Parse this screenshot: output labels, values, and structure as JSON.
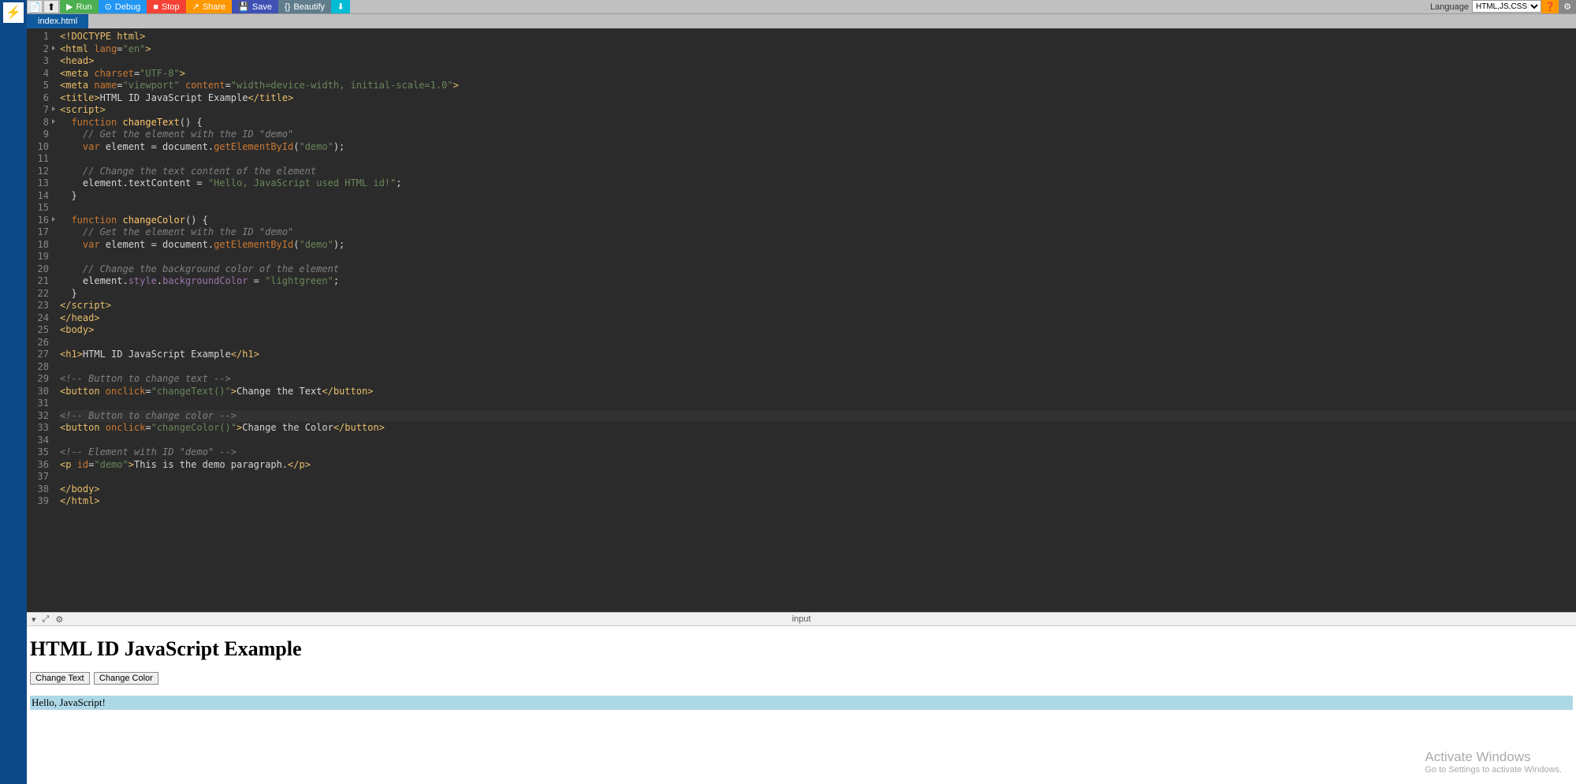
{
  "toolbar": {
    "run": "Run",
    "debug": "Debug",
    "stop": "Stop",
    "share": "Share",
    "save": "Save",
    "beautify": "Beautify",
    "language_label": "Language",
    "language_value": "HTML,JS,CSS"
  },
  "tab": {
    "name": "index.html"
  },
  "gutter_lines": [
    "1",
    "2",
    "3",
    "4",
    "5",
    "6",
    "7",
    "8",
    "9",
    "10",
    "11",
    "12",
    "13",
    "14",
    "15",
    "16",
    "17",
    "18",
    "19",
    "20",
    "21",
    "22",
    "23",
    "24",
    "25",
    "26",
    "27",
    "28",
    "29",
    "30",
    "31",
    "32",
    "33",
    "34",
    "35",
    "36",
    "37",
    "38",
    "39"
  ],
  "fold_lines": [
    2,
    7,
    8,
    16
  ],
  "highlighted_line": 32,
  "code": {
    "l1": {
      "a": "<!DOCTYPE ",
      "b": "html",
      "c": ">"
    },
    "l2": {
      "a": "<html ",
      "b": "lang",
      "c": "=",
      "d": "\"en\"",
      "e": ">"
    },
    "l3": {
      "a": "<head>"
    },
    "l4": {
      "a": "<meta ",
      "b": "charset",
      "c": "=",
      "d": "\"UTF-8\"",
      "e": ">"
    },
    "l5": {
      "a": "<meta ",
      "b": "name",
      "c": "=",
      "d": "\"viewport\"",
      "e": " ",
      "f": "content",
      "g": "=",
      "h": "\"width=device-width, initial-scale=1.0\"",
      "i": ">"
    },
    "l6": {
      "a": "<title>",
      "b": "HTML ID JavaScript Example",
      "c": "</title>"
    },
    "l7": {
      "a": "<script>"
    },
    "l8": {
      "a": "  function ",
      "b": "changeText",
      "c": "() ",
      "d": "{"
    },
    "l9": {
      "a": "    // Get the element with the ID \"demo\""
    },
    "l10": {
      "a": "    var ",
      "b": "element ",
      "c": "= ",
      "d": "document",
      "e": ".",
      "f": "getElementById",
      "g": "(",
      "h": "\"demo\"",
      "i": ");"
    },
    "l11": {
      "a": ""
    },
    "l12": {
      "a": "    // Change the text content of the element"
    },
    "l13": {
      "a": "    element",
      "b": ".",
      "c": "textContent ",
      "d": "= ",
      "e": "\"Hello, JavaScript used HTML id!\"",
      "f": ";"
    },
    "l14": {
      "a": "  }"
    },
    "l15": {
      "a": ""
    },
    "l16": {
      "a": "  function ",
      "b": "changeColor",
      "c": "() ",
      "d": "{"
    },
    "l17": {
      "a": "    // Get the element with the ID \"demo\""
    },
    "l18": {
      "a": "    var ",
      "b": "element ",
      "c": "= ",
      "d": "document",
      "e": ".",
      "f": "getElementById",
      "g": "(",
      "h": "\"demo\"",
      "i": ");"
    },
    "l19": {
      "a": ""
    },
    "l20": {
      "a": "    // Change the background color of the element"
    },
    "l21": {
      "a": "    element",
      "b": ".",
      "c": "style",
      "d": ".",
      "e": "backgroundColor ",
      "f": "= ",
      "g": "\"lightgreen\"",
      "h": ";"
    },
    "l22": {
      "a": "  }"
    },
    "l23": {
      "a": "</",
      "b": "script",
      "c": ">"
    },
    "l24": {
      "a": "</head>"
    },
    "l25": {
      "a": "<body>"
    },
    "l26": {
      "a": ""
    },
    "l27": {
      "a": "<h1>",
      "b": "HTML ID JavaScript Example",
      "c": "</h1>"
    },
    "l28": {
      "a": ""
    },
    "l29": {
      "a": "<!-- Button to change text -->"
    },
    "l30": {
      "a": "<button ",
      "b": "onclick",
      "c": "=",
      "d": "\"changeText()\"",
      "e": ">",
      "f": "Change the Text",
      "g": "</button>"
    },
    "l31": {
      "a": ""
    },
    "l32": {
      "a": "<!-- Button to change color -->"
    },
    "l33": {
      "a": "<button ",
      "b": "onclick",
      "c": "=",
      "d": "\"changeColor()\"",
      "e": ">",
      "f": "Change the Color",
      "g": "</button>"
    },
    "l34": {
      "a": ""
    },
    "l35": {
      "a": "<!-- Element with ID \"demo\" -->"
    },
    "l36": {
      "a": "<p ",
      "b": "id",
      "c": "=",
      "d": "\"demo\"",
      "e": ">",
      "f": "This is the demo paragraph.",
      "g": "</p>"
    },
    "l37": {
      "a": ""
    },
    "l38": {
      "a": "</body>"
    },
    "l39": {
      "a": "</html>"
    }
  },
  "output_bar": {
    "label": "input"
  },
  "output": {
    "heading": "HTML ID JavaScript Example",
    "btn1": "Change Text",
    "btn2": "Change Color",
    "paragraph": "Hello, JavaScript!"
  },
  "watermark": {
    "line1": "Activate Windows",
    "line2": "Go to Settings to activate Windows."
  }
}
